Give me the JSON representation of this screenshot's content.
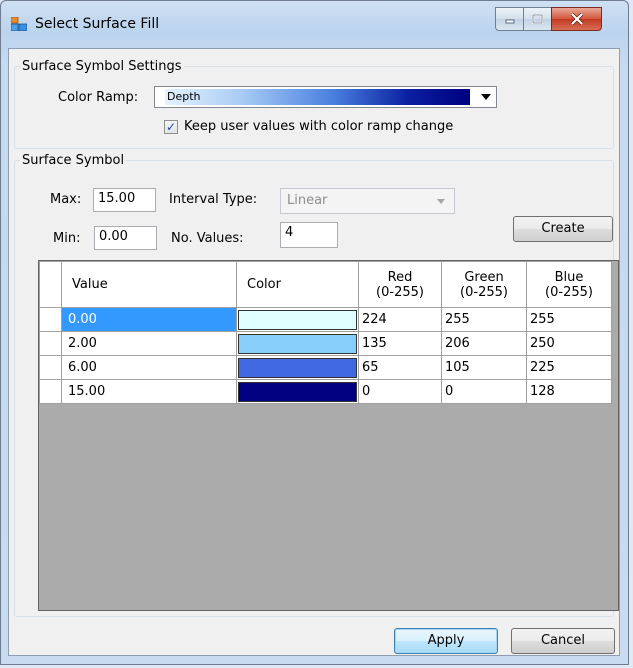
{
  "window": {
    "title": "Select Surface Fill"
  },
  "settings_group": {
    "legend": "Surface Symbol Settings",
    "color_ramp_label": "Color Ramp:",
    "color_ramp_value": "Depth",
    "keep_values_label": "Keep user values with color ramp change",
    "keep_values_checked": true
  },
  "symbol_group": {
    "legend": "Surface Symbol",
    "max_label": "Max:",
    "max_value": "15.00",
    "min_label": "Min:",
    "min_value": "0.00",
    "interval_type_label": "Interval Type:",
    "interval_type_value": "Linear",
    "no_values_label": "No. Values:",
    "no_values_value": "4",
    "create_label": "Create"
  },
  "table": {
    "headers": [
      "Value",
      "Color",
      "Red\n(0-255)",
      "Green\n(0-255)",
      "Blue\n(0-255)"
    ],
    "rows": [
      {
        "value": "0.00",
        "color": "#e0ffff",
        "red": "224",
        "green": "255",
        "blue": "255"
      },
      {
        "value": "2.00",
        "color": "#87cefa",
        "red": "135",
        "green": "206",
        "blue": "250"
      },
      {
        "value": "6.00",
        "color": "#4169e1",
        "red": "65",
        "green": "105",
        "blue": "225"
      },
      {
        "value": "15.00",
        "color": "#000080",
        "red": "0",
        "green": "0",
        "blue": "128"
      }
    ]
  },
  "footer": {
    "apply_label": "Apply",
    "cancel_label": "Cancel"
  },
  "colors": {
    "selected_row": "#3399ff",
    "grid_background": "#ababab"
  }
}
